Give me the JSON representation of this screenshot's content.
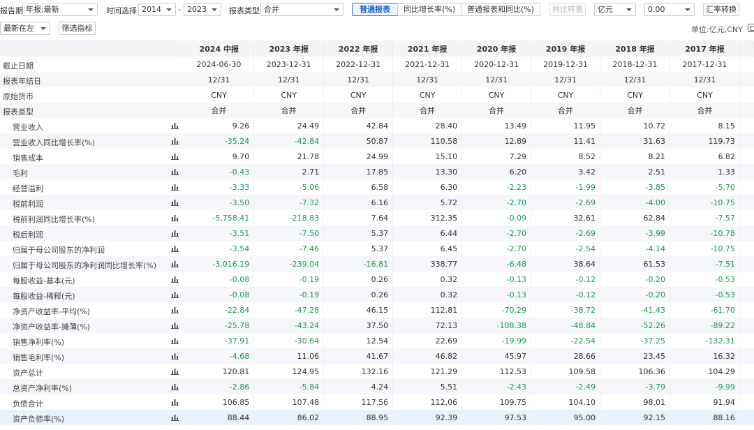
{
  "toolbar": {
    "report_period_label": "报告期",
    "report_period_value": "年报;最新",
    "time_label": "时间选择",
    "year_from": "2014",
    "year_dash": "-",
    "year_to": "2023",
    "report_type_label": "报表类型",
    "report_type_value": "合并",
    "tabs": [
      "普通报表",
      "同比增长率(%)",
      "普通报表和同比(%)"
    ],
    "active_tab": 0,
    "yoy_convert": "同比转置",
    "unit_value": "亿元",
    "decimal_value": "0.00",
    "fx_button": "汇率转换",
    "order_value": "最新在左",
    "filter_button": "筛选指标",
    "unit_text": "单位:亿元,CNY"
  },
  "table": {
    "columns": [
      "2024 中报",
      "2023 年报",
      "2022 年报",
      "2021 年报",
      "2020 年报",
      "2019 年报",
      "2018 年报",
      "2017 年报"
    ],
    "meta_rows": [
      {
        "name": "截止日期",
        "values": [
          "2024-06-30",
          "2023-12-31",
          "2022-12-31",
          "2021-12-31",
          "2020-12-31",
          "2019-12-31",
          "2018-12-31",
          "2017-12-31"
        ]
      },
      {
        "name": "报表年结日",
        "values": [
          "12/31",
          "12/31",
          "12/31",
          "12/31",
          "12/31",
          "12/31",
          "12/31",
          "12/31"
        ]
      },
      {
        "name": "原始货币",
        "values": [
          "CNY",
          "CNY",
          "CNY",
          "CNY",
          "CNY",
          "CNY",
          "CNY",
          "CNY"
        ]
      },
      {
        "name": "报表类型",
        "values": [
          "合并",
          "合并",
          "合并",
          "合并",
          "合并",
          "合并",
          "合并",
          "合并"
        ]
      }
    ],
    "rows": [
      {
        "name": "营业收入",
        "values": [
          "9.26",
          "24.49",
          "42.84",
          "28.40",
          "13.49",
          "11.95",
          "10.72",
          "8.15"
        ]
      },
      {
        "name": "营业收入同比增长率(%)",
        "values": [
          "-35.24",
          "-42.84",
          "50.87",
          "110.58",
          "12.89",
          "11.41",
          "31.63",
          "119.73"
        ]
      },
      {
        "name": "销售成本",
        "values": [
          "9.70",
          "21.78",
          "24.99",
          "15.10",
          "7.29",
          "8.52",
          "8.21",
          "6.82"
        ]
      },
      {
        "name": "毛利",
        "values": [
          "-0.43",
          "2.71",
          "17.85",
          "13.30",
          "6.20",
          "3.42",
          "2.51",
          "1.33"
        ]
      },
      {
        "name": "经营溢利",
        "values": [
          "-3.33",
          "-5.06",
          "6.58",
          "6.30",
          "-2.23",
          "-1.99",
          "-3.85",
          "-5.70"
        ]
      },
      {
        "name": "税前利润",
        "values": [
          "-3.50",
          "-7.32",
          "6.16",
          "5.72",
          "-2.70",
          "-2.69",
          "-4.00",
          "-10.75"
        ]
      },
      {
        "name": "税前利润同比增长率(%)",
        "values": [
          "-5,758.41",
          "-218.83",
          "7.64",
          "312.35",
          "-0.09",
          "32.61",
          "62.84",
          "-7.57"
        ]
      },
      {
        "name": "税后利润",
        "values": [
          "-3.51",
          "-7.50",
          "5.37",
          "6.44",
          "-2.70",
          "-2.69",
          "-3.99",
          "-10.78"
        ]
      },
      {
        "name": "归属于母公司股东的净利润",
        "values": [
          "-3.54",
          "-7.46",
          "5.37",
          "6.45",
          "-2.70",
          "-2.54",
          "-4.14",
          "-10.75"
        ]
      },
      {
        "name": "归属于母公司股东的净利润同比增长率(%)",
        "values": [
          "-3,016.19",
          "-239.04",
          "-16.81",
          "338.77",
          "-6.48",
          "38.64",
          "61.53",
          "-7.51"
        ]
      },
      {
        "name": "每股收益-基本(元)",
        "values": [
          "-0.08",
          "-0.19",
          "0.26",
          "0.32",
          "-0.13",
          "-0.12",
          "-0.20",
          "-0.53"
        ]
      },
      {
        "name": "每股收益-稀释(元)",
        "values": [
          "-0.08",
          "-0.19",
          "0.26",
          "0.32",
          "-0.13",
          "-0.12",
          "-0.20",
          "-0.53"
        ]
      },
      {
        "name": "净资产收益率-平均(%)",
        "values": [
          "-22.84",
          "-47.28",
          "46.15",
          "112.81",
          "-70.29",
          "-38.72",
          "-41.43",
          "-61.70"
        ]
      },
      {
        "name": "净资产收益率-摊薄(%)",
        "values": [
          "-25.78",
          "-43.24",
          "37.50",
          "72.13",
          "-108.38",
          "-48.84",
          "-52.26",
          "-89.22"
        ]
      },
      {
        "name": "销售净利率(%)",
        "values": [
          "-37.91",
          "-30.64",
          "12.54",
          "22.69",
          "-19.99",
          "-22.54",
          "-37.25",
          "-132.31"
        ]
      },
      {
        "name": "销售毛利率(%)",
        "values": [
          "-4.68",
          "11.06",
          "41.67",
          "46.82",
          "45.97",
          "28.66",
          "23.45",
          "16.32"
        ]
      },
      {
        "name": "资产总计",
        "values": [
          "120.81",
          "124.95",
          "132.16",
          "121.29",
          "112.53",
          "109.58",
          "106.36",
          "104.29"
        ]
      },
      {
        "name": "总资产净利率(%)",
        "values": [
          "-2.86",
          "-5.84",
          "4.24",
          "5.51",
          "-2.43",
          "-2.49",
          "-3.79",
          "-9.99"
        ]
      },
      {
        "name": "负债合计",
        "values": [
          "106.85",
          "107.48",
          "117.56",
          "112.06",
          "109.75",
          "104.10",
          "98.01",
          "91.94"
        ]
      },
      {
        "name": "资产负债率(%)",
        "values": [
          "88.44",
          "86.02",
          "88.95",
          "92.39",
          "97.53",
          "95.00",
          "92.15",
          "88.16"
        ]
      }
    ],
    "highlight_row": 19
  },
  "colors": {
    "negative": "#1a9a50",
    "accent": "#3a7bd5",
    "header_bg": "#f2f4f7"
  },
  "icons": {
    "row_chart": "bar-chart-icon",
    "dropdown": "chevron-down-icon",
    "export": "export-icon"
  }
}
